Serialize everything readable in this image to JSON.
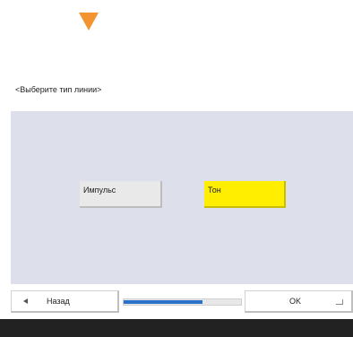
{
  "header": {
    "arrow_color": "#f29530"
  },
  "prompt_text": "<Выберите тип линии>",
  "options": [
    {
      "label": "Импульс",
      "selected": false
    },
    {
      "label": "Тон",
      "selected": true
    }
  ],
  "footer": {
    "back_label": "Назад",
    "ok_label": "OK",
    "progress_fraction": 0.67
  },
  "colors": {
    "selected_option": "#ffee00",
    "panel_background": "#dde0ea",
    "progress_fill": "#2b73c9",
    "bottom_bar": "#222222"
  }
}
